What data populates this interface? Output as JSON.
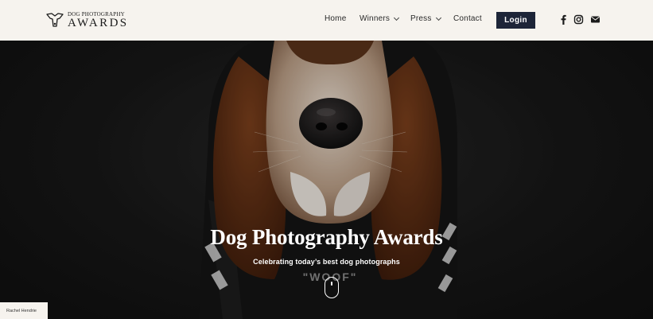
{
  "logo": {
    "small_text": "DOG PHOTOGRAPHY",
    "big_text": "AWARDS"
  },
  "nav": {
    "home": "Home",
    "winners": "Winners",
    "press": "Press",
    "contact": "Contact",
    "login": "Login"
  },
  "social": {
    "icons": [
      "facebook-icon",
      "instagram-icon",
      "email-icon"
    ]
  },
  "hero": {
    "title": "Dog Photography Awards",
    "subtitle": "Celebrating today’s best dog photographs",
    "hoodie_text": "\"WOOF\""
  },
  "photo_credit": "Rachel Hendrie",
  "colors": {
    "header_bg": "#f6f3ee",
    "login_bg": "#1d2538",
    "hero_bg": "#161616"
  }
}
